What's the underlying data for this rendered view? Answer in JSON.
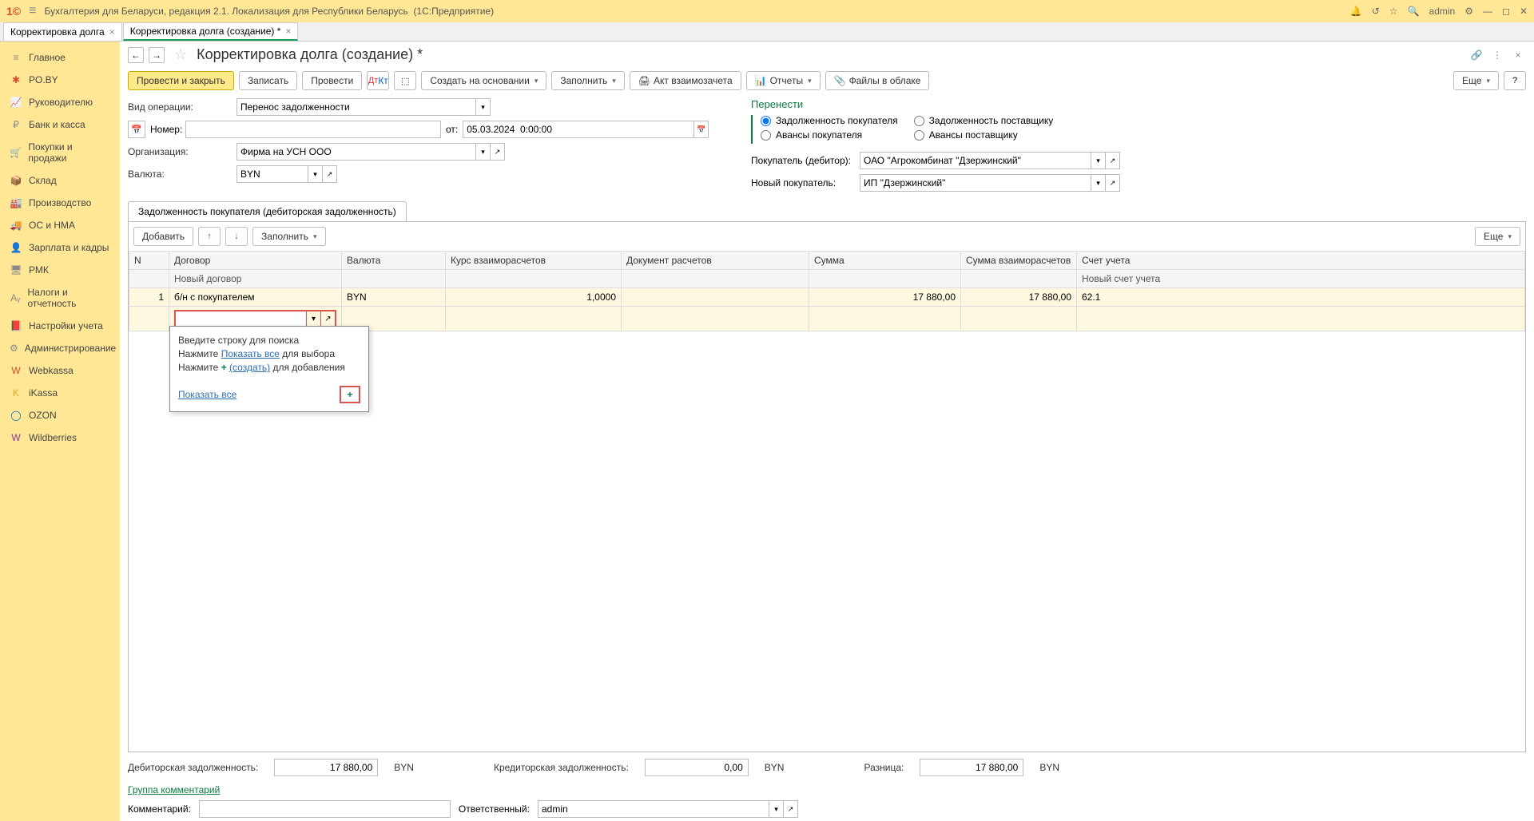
{
  "titlebar": {
    "app": "Бухгалтерия для Беларуси, редакция 2.1. Локализация для Республики Беларусь",
    "platform": "(1С:Предприятие)",
    "user": "admin"
  },
  "tabs": [
    {
      "label": "Корректировка долга"
    },
    {
      "label": "Корректировка долга (создание) *"
    }
  ],
  "sidebar": [
    {
      "icon": "≡",
      "label": "Главное",
      "color": "#888"
    },
    {
      "icon": "✱",
      "label": "PO.BY",
      "color": "#d94f2f"
    },
    {
      "icon": "📈",
      "label": "Руководителю",
      "color": "#888"
    },
    {
      "icon": "₽",
      "label": "Банк и касса",
      "color": "#888"
    },
    {
      "icon": "🛒",
      "label": "Покупки и продажи",
      "color": "#888"
    },
    {
      "icon": "📦",
      "label": "Склад",
      "color": "#888"
    },
    {
      "icon": "🏭",
      "label": "Производство",
      "color": "#888"
    },
    {
      "icon": "🚚",
      "label": "ОС и НМА",
      "color": "#888"
    },
    {
      "icon": "👤",
      "label": "Зарплата и кадры",
      "color": "#888"
    },
    {
      "icon": "🖥",
      "label": "РМК",
      "color": "#888"
    },
    {
      "icon": "Aᵧ",
      "label": "Налоги и отчетность",
      "color": "#888"
    },
    {
      "icon": "📕",
      "label": "Настройки учета",
      "color": "#888"
    },
    {
      "icon": "⚙",
      "label": "Администрирование",
      "color": "#888"
    },
    {
      "icon": "W",
      "label": "Webkassa",
      "color": "#d94f2f"
    },
    {
      "icon": "K",
      "label": "iKassa",
      "color": "#f0a020"
    },
    {
      "icon": "◯",
      "label": "OZON",
      "color": "#0066cc"
    },
    {
      "icon": "W",
      "label": "Wildberries",
      "color": "#8b3a99"
    }
  ],
  "page": {
    "title": "Корректировка долга (создание) *",
    "toolbar": {
      "post_close": "Провести и закрыть",
      "save": "Записать",
      "post": "Провести",
      "create_based": "Создать на основании",
      "fill": "Заполнить",
      "act": "Акт взаимозачета",
      "reports": "Отчеты",
      "files": "Файлы в облаке",
      "more": "Еще"
    },
    "form": {
      "op_label": "Вид операции:",
      "op_value": "Перенос задолженности",
      "num_label": "Номер:",
      "from_label": "от:",
      "date": "05.03.2024  0:00:00",
      "org_label": "Организация:",
      "org_value": "Фирма на УСН ООО",
      "cur_label": "Валюта:",
      "cur_value": "BYN",
      "transfer_title": "Перенести",
      "r1": "Задолженность покупателя",
      "r2": "Задолженность поставщику",
      "r3": "Авансы покупателя",
      "r4": "Авансы поставщику",
      "buyer_label": "Покупатель (дебитор):",
      "buyer_value": "ОАО \"Агрокомбинат \"Дзержинский\"",
      "newbuyer_label": "Новый покупатель:",
      "newbuyer_value": "ИП \"Дзержинский\""
    },
    "subtab": "Задолженность покупателя (дебиторская задолженность)",
    "tbtool": {
      "add": "Добавить",
      "fill": "Заполнить",
      "more": "Еще"
    },
    "cols": {
      "n": "N",
      "contract": "Договор",
      "currency": "Валюта",
      "rate": "Курс взаиморасчетов",
      "doc": "Документ расчетов",
      "sum": "Сумма",
      "sum_settle": "Сумма взаиморасчетов",
      "account": "Счет учета",
      "newcontract": "Новый договор",
      "newaccount": "Новый счет учета"
    },
    "row": {
      "n": "1",
      "contract": "б/н с покупателем",
      "currency": "BYN",
      "rate": "1,0000",
      "sum": "17 880,00",
      "sum_settle": "17 880,00",
      "account": "62.1"
    },
    "popup": {
      "l1": "Введите строку для поиска",
      "l2a": "Нажмите ",
      "l2b": "Показать все",
      "l2c": " для выбора",
      "l3a": "Нажмите ",
      "l3b": "(создать)",
      "l3c": " для добавления",
      "showall": "Показать все"
    },
    "footer": {
      "deb_label": "Дебиторская задолженность:",
      "deb_val": "17 880,00",
      "deb_cur": "BYN",
      "cred_label": "Кредиторская задолженность:",
      "cred_val": "0,00",
      "cred_cur": "BYN",
      "diff_label": "Разница:",
      "diff_val": "17 880,00",
      "diff_cur": "BYN",
      "comment_group": "Группа комментарий",
      "comment_label": "Комментарий:",
      "resp_label": "Ответственный:",
      "resp_val": "admin"
    }
  }
}
